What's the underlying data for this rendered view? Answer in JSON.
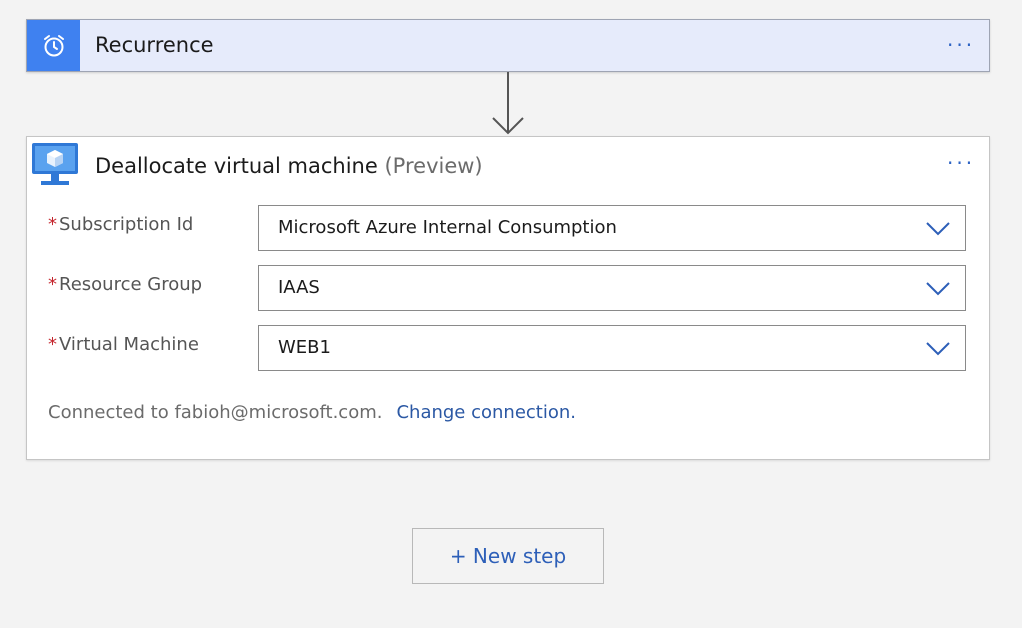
{
  "recurrence": {
    "title": "Recurrence",
    "icon": "alarm-clock-icon",
    "menu": "···"
  },
  "deallocate": {
    "title": "Deallocate virtual machine",
    "preview": "(Preview)",
    "icon": "virtual-machine-icon",
    "menu": "···",
    "required_marker": "*",
    "fields": [
      {
        "label": "Subscription Id",
        "value": "Microsoft Azure Internal Consumption"
      },
      {
        "label": "Resource Group",
        "value": "IAAS"
      },
      {
        "label": "Virtual Machine",
        "value": "WEB1"
      }
    ],
    "connection_text": "Connected to fabioh@microsoft.com.",
    "change_connection": "Change connection."
  },
  "new_step": "+ New step",
  "colors": {
    "recurrence_bg": "#e6ebfb",
    "recurrence_icon_bg": "#3f81f0",
    "link": "#2b58a4",
    "required": "#c4262e"
  }
}
